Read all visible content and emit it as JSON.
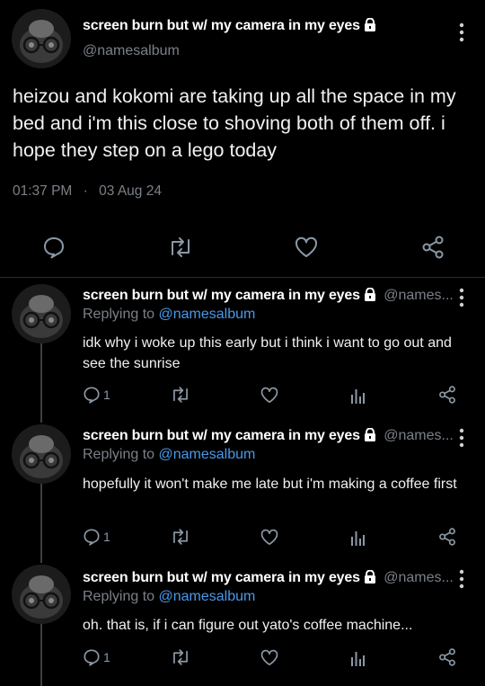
{
  "main_tweet": {
    "display_name": "screen burn but w/ my camera in my eyes",
    "handle": "@namesalbum",
    "text": "heizou and kokomi are taking up all the space in my bed and i'm this close to shoving both of them off. i hope they step on a lego today",
    "time": "01:37 PM",
    "separator": "·",
    "date": "03 Aug 24"
  },
  "replies": [
    {
      "display_name": "screen burn but w/ my camera in my eyes",
      "handle": "@names...",
      "replying_prefix": "Replying to",
      "replying_handle": "@namesalbum",
      "text": "idk why i woke up this early but i think i want to go out and see the sunrise",
      "reply_count": "1"
    },
    {
      "display_name": "screen burn but w/ my camera in my eyes",
      "handle": "@names...",
      "replying_prefix": "Replying to",
      "replying_handle": "@namesalbum",
      "text": "hopefully it won't make me late but i'm making a coffee first",
      "reply_count": "1"
    },
    {
      "display_name": "screen burn but w/ my camera in my eyes",
      "handle": "@names...",
      "replying_prefix": "Replying to",
      "replying_handle": "@namesalbum",
      "text": "oh. that is, if i can figure out yato's coffee machine...",
      "reply_count": "1"
    }
  ],
  "icons": {
    "reply": "reply-icon",
    "retweet": "retweet-icon",
    "like": "like-icon",
    "views": "views-icon",
    "share": "share-icon",
    "lock": "lock-icon",
    "more": "more-icon"
  },
  "colors": {
    "background": "#000000",
    "text": "#e7e9ea",
    "muted": "#7b8087",
    "mention": "#4a99e9"
  }
}
